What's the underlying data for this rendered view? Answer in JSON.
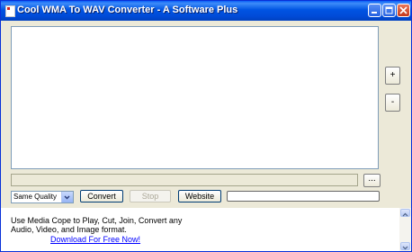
{
  "window": {
    "title": "Cool WMA To WAV Converter - A Software Plus"
  },
  "side_buttons": {
    "add_label": "+",
    "remove_label": "-"
  },
  "path": {
    "browse_label": "..."
  },
  "controls": {
    "quality_value": "Same Quality",
    "convert_label": "Convert",
    "stop_label": "Stop",
    "website_label": "Website"
  },
  "ad": {
    "line1": "Use Media Cope to Play, Cut, Join, Convert any",
    "line2": "Audio, Video, and Image format.",
    "link": "Download For Free Now!"
  },
  "icons": {
    "app": "app-icon",
    "minimize": "minimize-icon",
    "maximize": "maximize-icon",
    "close": "close-icon",
    "dropdown": "chevron-down-icon"
  },
  "colors": {
    "titlebar": "#0054e3",
    "window_bg": "#ece9d8",
    "link": "#0000ff",
    "close_button": "#c5381b"
  }
}
